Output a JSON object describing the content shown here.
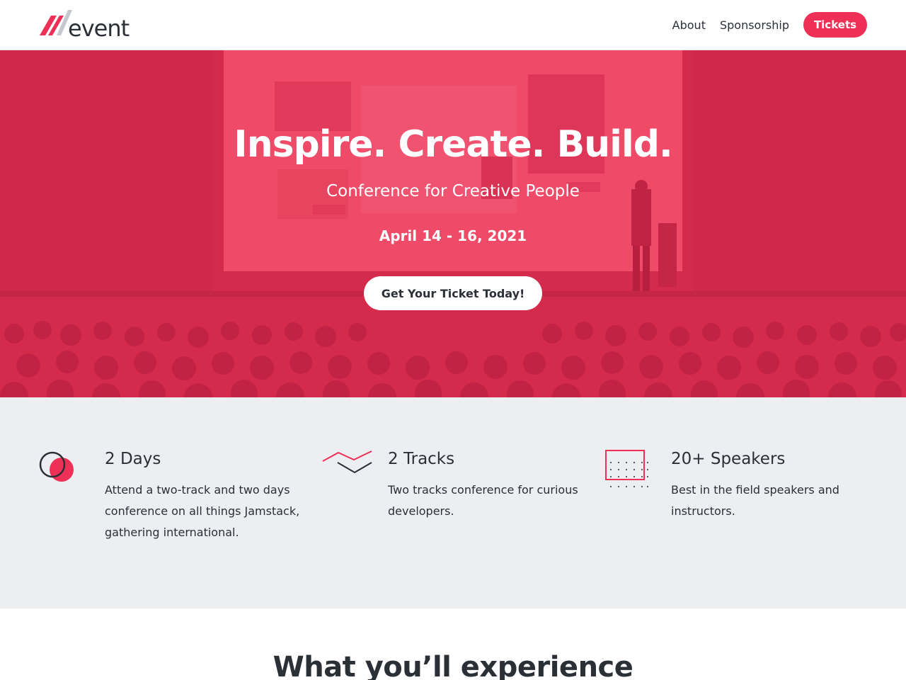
{
  "brand": {
    "name": "event",
    "accent": "#ee2f56"
  },
  "nav": {
    "links": [
      "About",
      "Sponsorship"
    ],
    "cta": "Tickets"
  },
  "hero": {
    "title": "Inspire. Create. Build.",
    "subtitle": "Conference for Creative People",
    "date": "April 14 - 16, 2021",
    "cta": "Get Your Ticket Today!",
    "overlay_color": "#d42a4c"
  },
  "features": [
    {
      "icon": "circles-icon",
      "title": "2 Days",
      "description": "Attend a two-track and two days conference on all things Jamstack, gathering international."
    },
    {
      "icon": "tracks-icon",
      "title": "2 Tracks",
      "description": "Two tracks conference for curious developers."
    },
    {
      "icon": "dot-grid-icon",
      "title": "20+ Speakers",
      "description": "Best in the field speakers and instructors."
    }
  ],
  "experience": {
    "title": "What you’ll experience"
  }
}
